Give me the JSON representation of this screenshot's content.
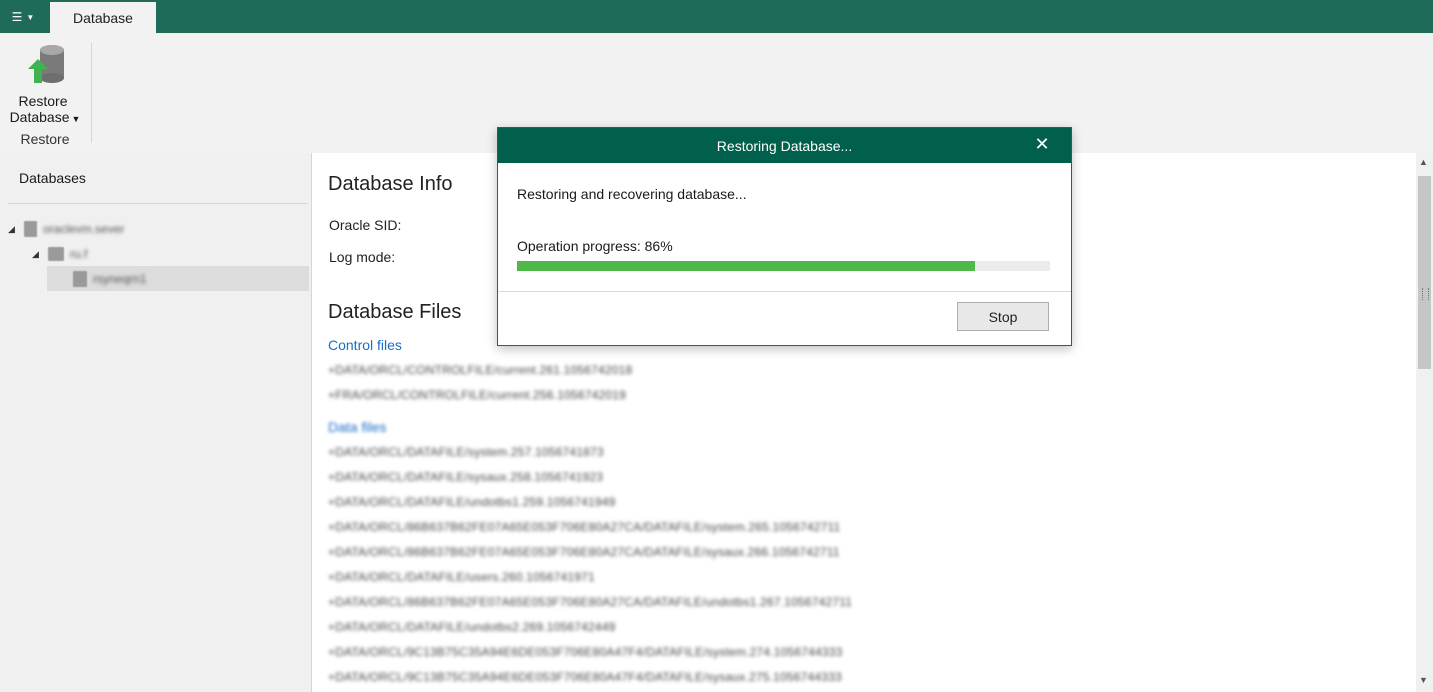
{
  "topbar": {
    "menu_icon": "hamburger-menu-icon",
    "tab_label": "Database",
    "accent_color": "#1f6b5a"
  },
  "ribbon": {
    "restore_button_line1": "Restore",
    "restore_button_line2": "Database",
    "group_label": "Restore"
  },
  "left_panel": {
    "title": "Databases",
    "tree": [
      {
        "label": "oraclevm.sever",
        "level": 0,
        "icon": "server-icon"
      },
      {
        "label": "ru.f",
        "level": 1,
        "icon": "instance-icon"
      },
      {
        "label": "rsyneqrn1",
        "level": 2,
        "icon": "database-icon",
        "selected": true
      }
    ]
  },
  "main": {
    "info_heading": "Database Info",
    "oracle_sid_label": "Oracle SID:",
    "log_mode_label": "Log mode:",
    "files_heading": "Database Files",
    "control_files_link": "Control files",
    "control_files": [
      "+DATA/ORCL/CONTROLFILE/current.261.1056742018",
      "+FRA/ORCL/CONTROLFILE/current.256.1056742019"
    ],
    "data_files_link": "Data files",
    "data_files": [
      "+DATA/ORCL/DATAFILE/system.257.1056741873",
      "+DATA/ORCL/DATAFILE/sysaux.258.1056741923",
      "+DATA/ORCL/DATAFILE/undotbs1.259.1056741949",
      "+DATA/ORCL/86B637B62FE07A65E053F706E80A27CA/DATAFILE/system.265.1056742711",
      "+DATA/ORCL/86B637B62FE07A65E053F706E80A27CA/DATAFILE/sysaux.266.1056742711",
      "+DATA/ORCL/DATAFILE/users.260.1056741971",
      "+DATA/ORCL/86B637B62FE07A65E053F706E80A27CA/DATAFILE/undotbs1.267.1056742711",
      "+DATA/ORCL/DATAFILE/undotbs2.269.1056742449",
      "+DATA/ORCL/9C13B75C35A94E6DE053F706E80A47F4/DATAFILE/system.274.1056744333",
      "+DATA/ORCL/9C13B75C35A94E6DE053F706E80A47F4/DATAFILE/sysaux.275.1056744333"
    ]
  },
  "dialog": {
    "title": "Restoring Database...",
    "message": "Restoring and recovering database...",
    "progress_label": "Operation progress:  86%",
    "progress": 86,
    "progress_color": "#4fb848",
    "stop_label": "Stop",
    "close_icon": "close-icon"
  }
}
